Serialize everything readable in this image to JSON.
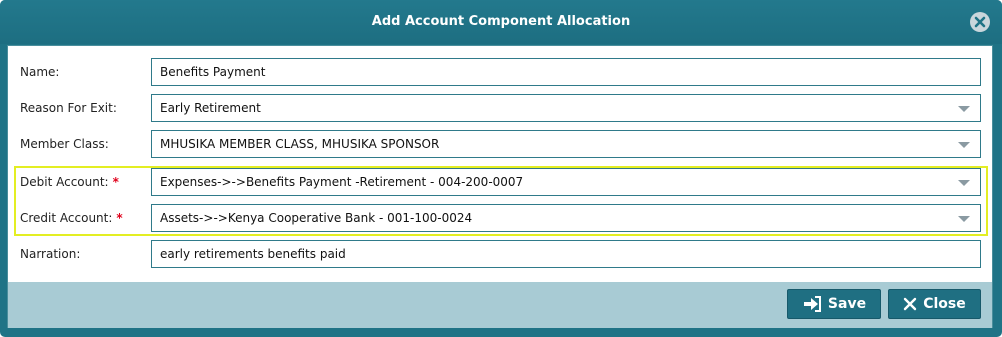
{
  "dialog": {
    "title": "Add Account Component Allocation",
    "close_icon": "close-icon"
  },
  "form": {
    "name": {
      "label": "Name:",
      "value": "Benefits Payment"
    },
    "reason_for_exit": {
      "label": "Reason For Exit:",
      "value": "Early Retirement"
    },
    "member_class": {
      "label": "Member Class:",
      "value": "MHUSIKA MEMBER CLASS, MHUSIKA SPONSOR"
    },
    "debit_account": {
      "label": "Debit Account:",
      "required_mark": "*",
      "value": "Expenses->->Benefits Payment -Retirement - 004-200-0007"
    },
    "credit_account": {
      "label": "Credit Account:",
      "required_mark": "*",
      "value": "Assets->->Kenya Cooperative Bank - 001-100-0024"
    },
    "narration": {
      "label": "Narration:",
      "value": "early retirements benefits paid"
    }
  },
  "footer": {
    "save_label": "Save",
    "close_label": "Close"
  },
  "colors": {
    "titlebar": "#1f7386",
    "highlight": "#e3ee23",
    "required": "#e0001b",
    "footer": "#a8cbd4",
    "button": "#1f6f82"
  }
}
